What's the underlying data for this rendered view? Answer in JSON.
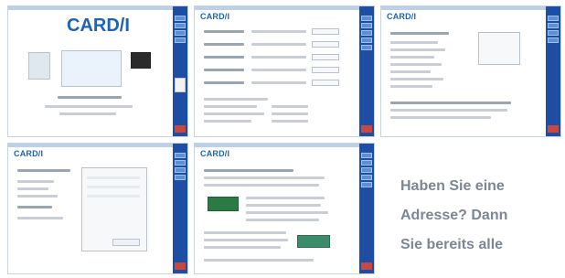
{
  "thumbnails": [
    {
      "id": "shot-1",
      "logo": "CARD/I",
      "title": "CARD/I"
    },
    {
      "id": "shot-2",
      "logo": "CARD/I"
    },
    {
      "id": "shot-3",
      "logo": "CARD/I"
    },
    {
      "id": "shot-4",
      "logo": "CARD/I"
    },
    {
      "id": "shot-5",
      "logo": "CARD/I"
    }
  ],
  "caption": {
    "line1": "Haben Sie eine",
    "line2": "Adresse? Dann",
    "line3": "Sie bereits alle"
  },
  "colors": {
    "sidebar_blue": "#1d4ea3",
    "accent_blue": "#1f64b3",
    "caption_gray": "#7b8794"
  }
}
